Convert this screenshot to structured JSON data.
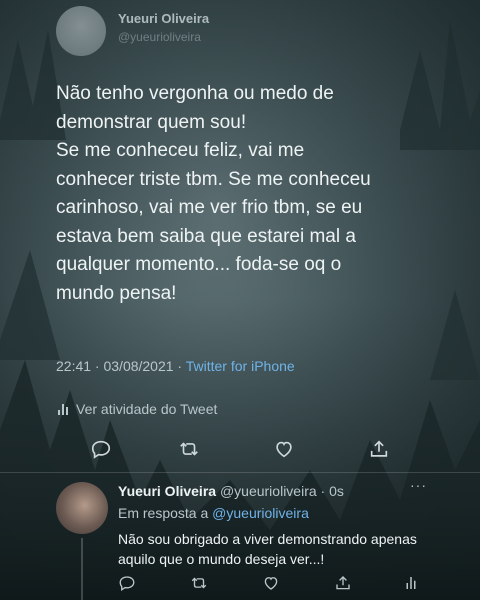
{
  "tweet": {
    "author_name": "Yueuri Oliveira",
    "author_handle": "@yueurioliveira",
    "text": "Não tenho vergonha ou medo de\ndemonstrar quem sou!\nSe me conheceu feliz, vai me\nconhecer triste tbm. Se me conheceu\ncarinhoso, vai me ver frio tbm, se eu\nestava bem saiba que estarei mal a\nqualquer momento... foda-se oq o\nmundo pensa!",
    "time": "22:41 · 03/08/2021 · ",
    "client": "Twitter for iPhone",
    "activity_label": "Ver atividade do Tweet"
  },
  "actions": {
    "reply_icon": "reply-icon",
    "retweet_icon": "retweet-icon",
    "like_icon": "heart-icon",
    "share_icon": "share-icon"
  },
  "reply": {
    "author_name": "Yueuri Oliveira",
    "author_handle_time": " @yueurioliveira · 0s",
    "more": "···",
    "in_reply_prefix": "Em resposta a ",
    "in_reply_mention": "@yueurioliveira",
    "text": "Não sou obrigado a viver demonstrando apenas aquilo que o mundo deseja ver...!"
  },
  "colors": {
    "link": "#6fb3e8",
    "text": "#eef3f4",
    "muted": "#b9c6ca"
  }
}
